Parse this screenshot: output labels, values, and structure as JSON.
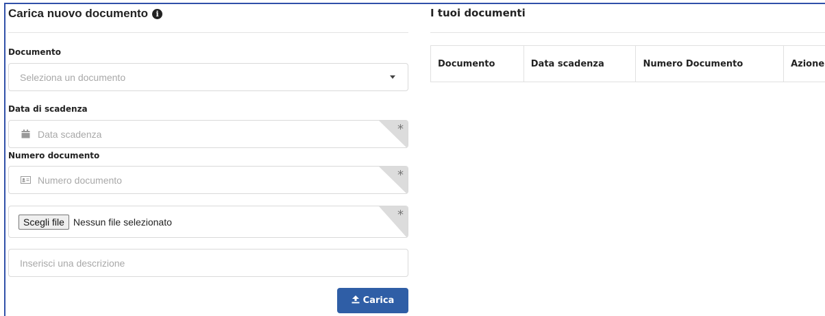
{
  "upload_panel": {
    "title": "Carica nuovo documento",
    "info_icon": "info-circle-icon",
    "document_label": "Documento",
    "document_select_placeholder": "Seleziona un documento",
    "expiry_label": "Data di scadenza",
    "expiry_placeholder": "Data scadenza",
    "expiry_icon": "calendar-icon",
    "number_label": "Numero documento",
    "number_placeholder": "Numero documento",
    "number_icon": "id-card-icon",
    "required_marker": "*",
    "file_button_label": "Scegli file",
    "file_status": "Nessun file selezionato",
    "description_placeholder": "Inserisci una descrizione",
    "upload_button_label": "Carica",
    "upload_icon": "upload-icon",
    "accent_color": "#2f5ea6"
  },
  "documents_panel": {
    "title": "I tuoi documenti",
    "columns": [
      "Documento",
      "Data scadenza",
      "Numero Documento",
      "Azione"
    ]
  }
}
